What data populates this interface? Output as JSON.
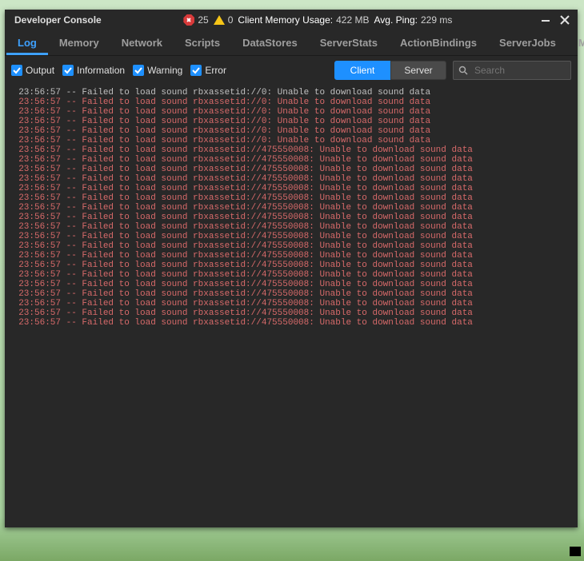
{
  "window": {
    "title": "Developer Console"
  },
  "stats": {
    "errors": "25",
    "warnings": "0",
    "mem_label": "Client Memory Usage:",
    "mem_value": "422 MB",
    "ping_label": "Avg. Ping:",
    "ping_value": "229 ms"
  },
  "tabs": [
    {
      "label": "Log",
      "active": true
    },
    {
      "label": "Memory"
    },
    {
      "label": "Network"
    },
    {
      "label": "Scripts"
    },
    {
      "label": "DataStores"
    },
    {
      "label": "ServerStats"
    },
    {
      "label": "ActionBindings"
    },
    {
      "label": "ServerJobs"
    },
    {
      "label": "MicroProfiler"
    }
  ],
  "filters": {
    "output": "Output",
    "information": "Information",
    "warning": "Warning",
    "error": "Error"
  },
  "toggle": {
    "client": "Client",
    "server": "Server"
  },
  "search": {
    "placeholder": "Search"
  },
  "log_lines": [
    {
      "ts": "23:56:57",
      "msg": "Failed to load sound rbxassetid://0: Unable to download sound data",
      "cls": "info"
    },
    {
      "ts": "23:56:57",
      "msg": "Failed to load sound rbxassetid://0: Unable to download sound data",
      "cls": "err"
    },
    {
      "ts": "23:56:57",
      "msg": "Failed to load sound rbxassetid://0: Unable to download sound data",
      "cls": "err"
    },
    {
      "ts": "23:56:57",
      "msg": "Failed to load sound rbxassetid://0: Unable to download sound data",
      "cls": "err"
    },
    {
      "ts": "23:56:57",
      "msg": "Failed to load sound rbxassetid://0: Unable to download sound data",
      "cls": "err"
    },
    {
      "ts": "23:56:57",
      "msg": "Failed to load sound rbxassetid://0: Unable to download sound data",
      "cls": "err"
    },
    {
      "ts": "23:56:57",
      "msg": "Failed to load sound rbxassetid://475550008: Unable to download sound data",
      "cls": "err"
    },
    {
      "ts": "23:56:57",
      "msg": "Failed to load sound rbxassetid://475550008: Unable to download sound data",
      "cls": "err"
    },
    {
      "ts": "23:56:57",
      "msg": "Failed to load sound rbxassetid://475550008: Unable to download sound data",
      "cls": "err"
    },
    {
      "ts": "23:56:57",
      "msg": "Failed to load sound rbxassetid://475550008: Unable to download sound data",
      "cls": "err"
    },
    {
      "ts": "23:56:57",
      "msg": "Failed to load sound rbxassetid://475550008: Unable to download sound data",
      "cls": "err"
    },
    {
      "ts": "23:56:57",
      "msg": "Failed to load sound rbxassetid://475550008: Unable to download sound data",
      "cls": "err"
    },
    {
      "ts": "23:56:57",
      "msg": "Failed to load sound rbxassetid://475550008: Unable to download sound data",
      "cls": "err"
    },
    {
      "ts": "23:56:57",
      "msg": "Failed to load sound rbxassetid://475550008: Unable to download sound data",
      "cls": "err"
    },
    {
      "ts": "23:56:57",
      "msg": "Failed to load sound rbxassetid://475550008: Unable to download sound data",
      "cls": "err"
    },
    {
      "ts": "23:56:57",
      "msg": "Failed to load sound rbxassetid://475550008: Unable to download sound data",
      "cls": "err"
    },
    {
      "ts": "23:56:57",
      "msg": "Failed to load sound rbxassetid://475550008: Unable to download sound data",
      "cls": "err"
    },
    {
      "ts": "23:56:57",
      "msg": "Failed to load sound rbxassetid://475550008: Unable to download sound data",
      "cls": "err"
    },
    {
      "ts": "23:56:57",
      "msg": "Failed to load sound rbxassetid://475550008: Unable to download sound data",
      "cls": "err"
    },
    {
      "ts": "23:56:57",
      "msg": "Failed to load sound rbxassetid://475550008: Unable to download sound data",
      "cls": "err"
    },
    {
      "ts": "23:56:57",
      "msg": "Failed to load sound rbxassetid://475550008: Unable to download sound data",
      "cls": "err"
    },
    {
      "ts": "23:56:57",
      "msg": "Failed to load sound rbxassetid://475550008: Unable to download sound data",
      "cls": "err"
    },
    {
      "ts": "23:56:57",
      "msg": "Failed to load sound rbxassetid://475550008: Unable to download sound data",
      "cls": "err"
    },
    {
      "ts": "23:56:57",
      "msg": "Failed to load sound rbxassetid://475550008: Unable to download sound data",
      "cls": "err"
    },
    {
      "ts": "23:56:57",
      "msg": "Failed to load sound rbxassetid://475550008: Unable to download sound data",
      "cls": "err"
    }
  ]
}
